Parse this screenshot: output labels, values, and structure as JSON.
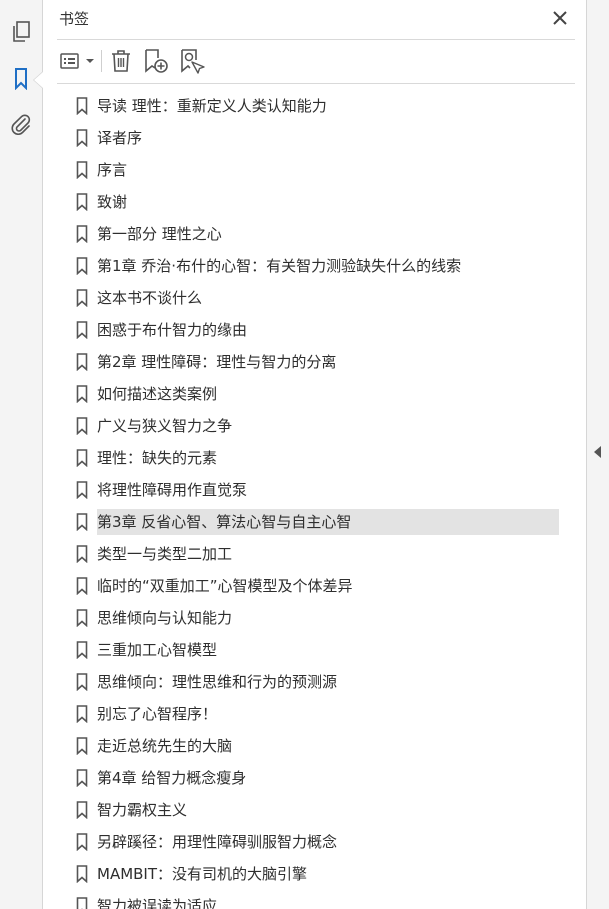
{
  "rail": {
    "items": [
      {
        "name": "pages-icon"
      },
      {
        "name": "bookmarks-icon"
      },
      {
        "name": "attachments-icon"
      }
    ]
  },
  "panel": {
    "title": "书签",
    "close_icon": "close-icon"
  },
  "toolbar": {
    "items": [
      "options-menu-icon",
      "delete-bookmark-icon",
      "new-bookmark-icon",
      "find-current-bookmark-icon"
    ]
  },
  "bookmarks": [
    {
      "label": "导读 理性：重新定义人类认知能力"
    },
    {
      "label": "译者序"
    },
    {
      "label": "序言"
    },
    {
      "label": "致谢"
    },
    {
      "label": "第一部分 理性之心"
    },
    {
      "label": "第1章 乔治·布什的心智：有关智力测验缺失什么的线索"
    },
    {
      "label": "这本书不谈什么"
    },
    {
      "label": "困惑于布什智力的缘由"
    },
    {
      "label": "第2章 理性障碍：理性与智力的分离"
    },
    {
      "label": "如何描述这类案例"
    },
    {
      "label": "广义与狭义智力之争"
    },
    {
      "label": "理性：缺失的元素"
    },
    {
      "label": "将理性障碍用作直觉泵"
    },
    {
      "label": "第3章 反省心智、算法心智与自主心智",
      "selected": true
    },
    {
      "label": "类型一与类型二加工"
    },
    {
      "label": "临时的“双重加工”心智模型及个体差异"
    },
    {
      "label": "思维倾向与认知能力"
    },
    {
      "label": "三重加工心智模型"
    },
    {
      "label": "思维倾向：理性思维和行为的预测源"
    },
    {
      "label": "别忘了心智程序！"
    },
    {
      "label": "走近总统先生的大脑"
    },
    {
      "label": "第4章 给智力概念瘦身"
    },
    {
      "label": "智力霸权主义"
    },
    {
      "label": "另辟蹊径：用理性障碍驯服智力概念"
    },
    {
      "label": "MAMBIT：没有司机的大脑引擎"
    },
    {
      "label": "智力被误读为适应"
    }
  ],
  "colors": {
    "accent": "#1f6fc5",
    "selected_bg": "#e3e3e3",
    "rail_bg": "#f4f4f4"
  }
}
